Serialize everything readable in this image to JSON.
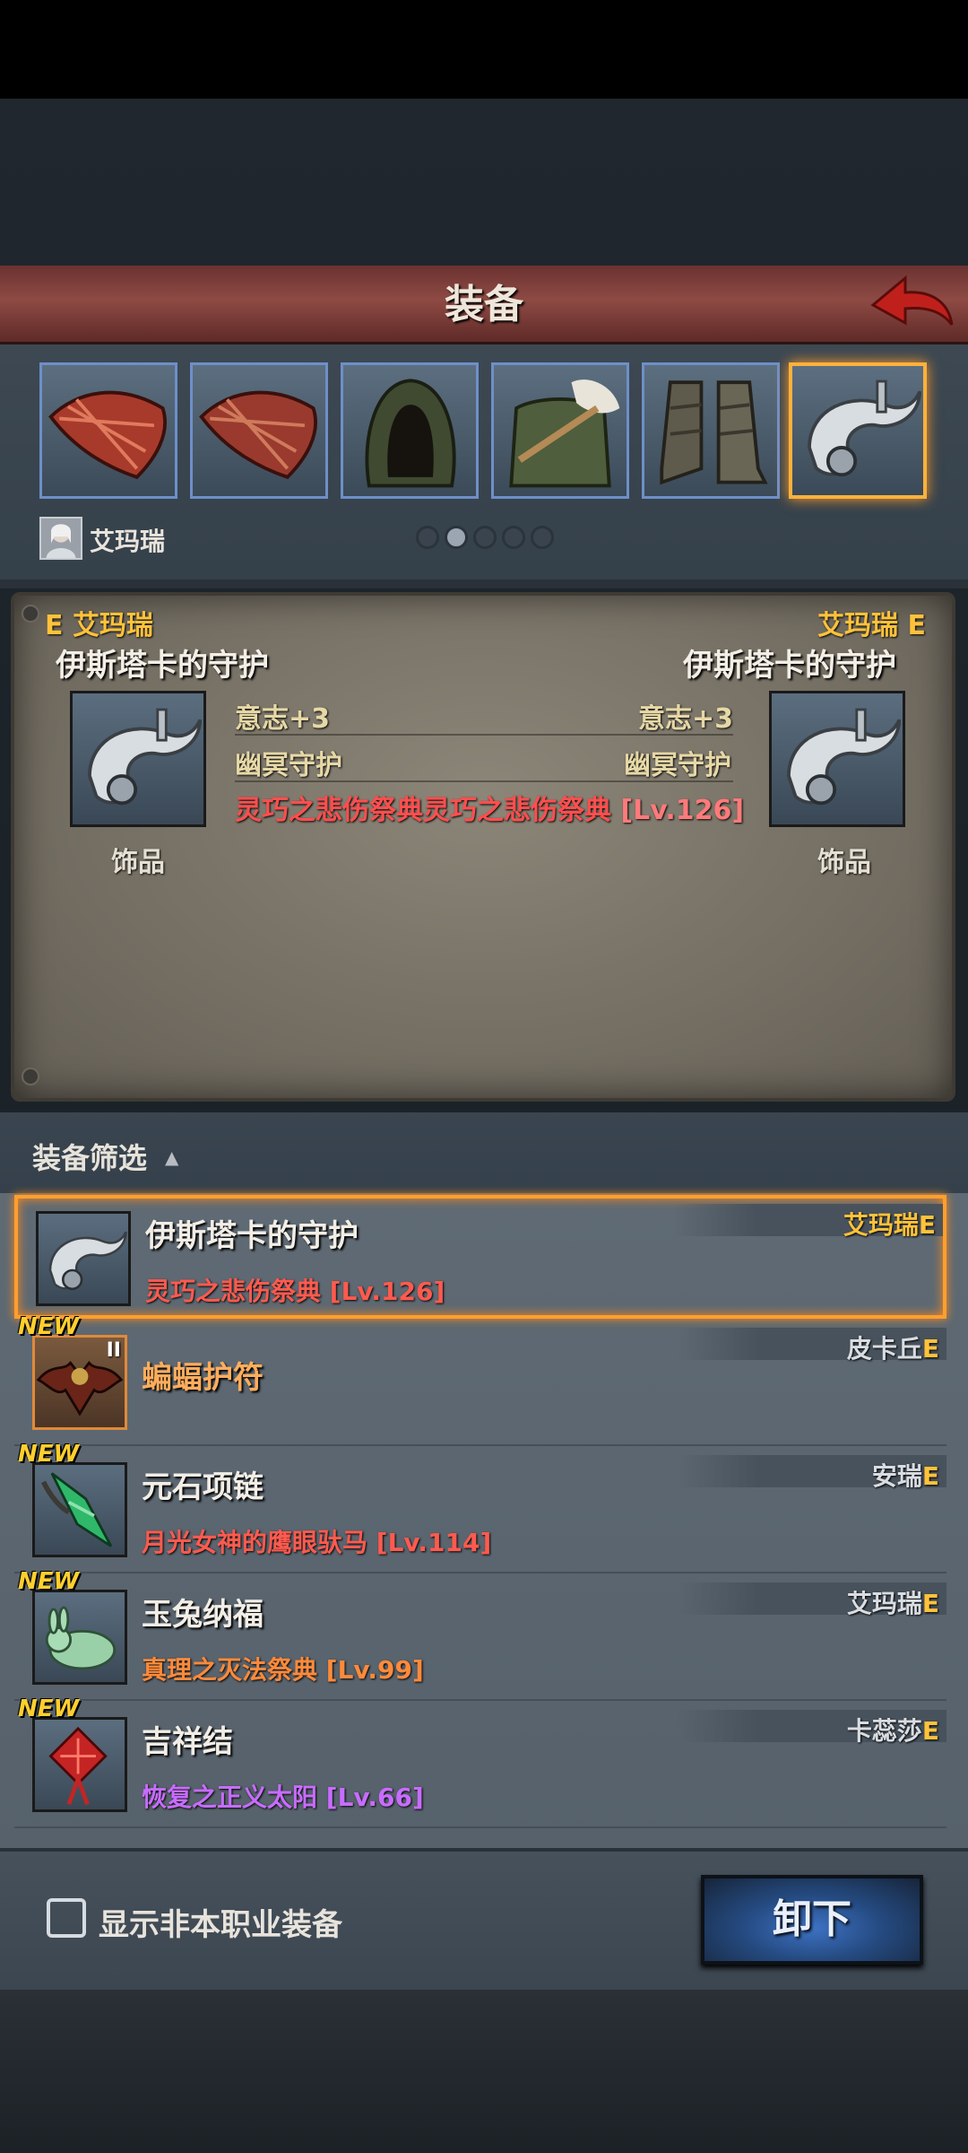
{
  "header": {
    "title": "装备"
  },
  "slots": [
    {
      "icon": "claw-weapon-icon"
    },
    {
      "icon": "claw-weapon-icon"
    },
    {
      "icon": "hood-icon"
    },
    {
      "icon": "fur-coat-icon"
    },
    {
      "icon": "boots-icon"
    },
    {
      "icon": "silver-charm-icon",
      "selected": true
    }
  ],
  "character": {
    "name": "艾玛瑞"
  },
  "pagination": {
    "total": 5,
    "active": 2
  },
  "compare": {
    "left": {
      "tag": "E 艾玛瑞",
      "title": "伊斯塔卡的守护",
      "type": "饰品"
    },
    "right": {
      "tag": "艾玛瑞 E",
      "title": "伊斯塔卡的守护",
      "type": "饰品"
    },
    "stat_left_1": "意志+3",
    "stat_right_1": "意志+3",
    "stat_left_2": "幽冥守护",
    "stat_right_2": "幽冥守护",
    "set_name": "灵巧之悲伤祭典灵巧之悲伤祭典",
    "set_level": "[Lv.126]"
  },
  "filter": {
    "label": "装备筛选",
    "arrow": "▲"
  },
  "items": [
    {
      "name": "伊斯塔卡的守护",
      "set": "灵巧之悲伤祭典",
      "level": "[Lv.126]",
      "owner": "艾玛瑞",
      "owner_suffix": "E",
      "new_label": "",
      "set_color": "#ff5a4e"
    },
    {
      "name": "蝙蝠护符",
      "set": "",
      "level": "",
      "owner": "皮卡丘",
      "owner_suffix": "E",
      "new_label": "NEW",
      "roman": "II"
    },
    {
      "name": "元石项链",
      "set": "月光女神的鹰眼驮马",
      "level": "[Lv.114]",
      "owner": "安瑞",
      "owner_suffix": "E",
      "new_label": "NEW",
      "set_color": "#ff5a4e"
    },
    {
      "name": "玉兔纳福",
      "set": "真理之灭法祭典",
      "level": "[Lv.99]",
      "owner": "艾玛瑞",
      "owner_suffix": "E",
      "new_label": "NEW",
      "set_color": "#ff8a3a"
    },
    {
      "name": "吉祥结",
      "set": "恢复之正义太阳",
      "level": "[Lv.66]",
      "owner": "卡蕊莎",
      "owner_suffix": "E",
      "new_label": "NEW",
      "set_color": "#c86cff"
    }
  ],
  "bottom": {
    "checkbox_label": "显示非本职业装备",
    "unequip_label": "卸下"
  },
  "colors": {
    "accent_gold": "#ffc23a",
    "set_red": "#ff4e4e",
    "selected_border": "#ff9f2e",
    "slot_border": "#6e8fc9"
  }
}
